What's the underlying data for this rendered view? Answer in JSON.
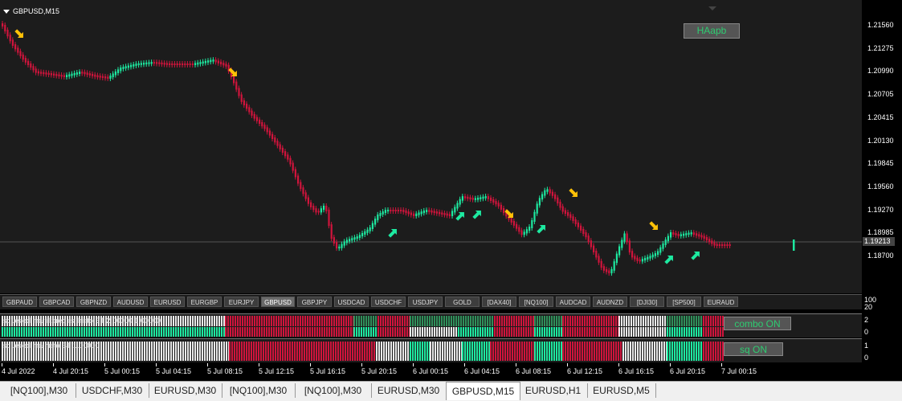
{
  "chart": {
    "title": "GBPUSD,M15",
    "indicator_label": "HAapb",
    "current_price": "1.19213",
    "y_labels": [
      "1.21560",
      "1.21275",
      "1.20990",
      "1.20705",
      "1.20415",
      "1.20130",
      "1.19845",
      "1.19560",
      "1.19270",
      "1.18985",
      "1.18700"
    ],
    "colors": {
      "bull": "#1de9a0",
      "bear": "#d0143c",
      "arrow": "#ffc107",
      "green_arrow": "#1de9a0"
    }
  },
  "symbols": [
    "GBPAUD",
    "GBPCAD",
    "GBPNZD",
    "AUDUSD",
    "EURUSD",
    "EURGBP",
    "EURJPY",
    "GBPUSD",
    "GBPJPY",
    "USDCAD",
    "USDCHF",
    "USDJPY",
    "GOLD",
    "[DAX40]",
    "[NQ100]",
    "AUDCAD",
    "AUDNZD",
    "[DJI30]",
    "[SP500]",
    "EURAUD"
  ],
  "active_symbol": "GBPUSD",
  "sym_axis": [
    "100",
    "20"
  ],
  "pane1": {
    "label": "squezed ma filtered rsi histo BT 2.00000 1.00000",
    "button": "combo ON",
    "axis": [
      "2",
      "0"
    ]
  },
  "pane2": {
    "label": "squezed ma histo BT 1.00000",
    "button": "sq ON",
    "axis": [
      "1",
      "0"
    ]
  },
  "x_labels": [
    "4 Jul 2022",
    "4 Jul 20:15",
    "5 Jul 00:15",
    "5 Jul 04:15",
    "5 Jul 08:15",
    "5 Jul 12:15",
    "5 Jul 16:15",
    "5 Jul 20:15",
    "6 Jul 00:15",
    "6 Jul 04:15",
    "6 Jul 08:15",
    "6 Jul 12:15",
    "6 Jul 16:15",
    "6 Jul 20:15",
    "7 Jul 00:15"
  ],
  "tabs": [
    "[NQ100],M30",
    "USDCHF,M30",
    "EURUSD,M30",
    "[NQ100],M30",
    "[NQ100],M30",
    "EURUSD,M30",
    "GBPUSD,M15",
    "EURUSD,H1",
    "EURUSD,M5"
  ],
  "active_tab": "GBPUSD,M15"
}
